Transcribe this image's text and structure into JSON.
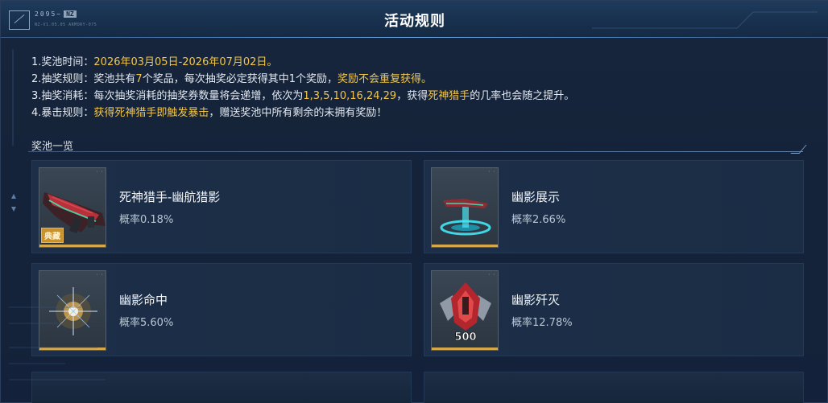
{
  "header": {
    "brand": "2095",
    "brand_tag": "NZ",
    "brand_sub": "NZ-V1.05.05 ARMORY-075",
    "title": "活动规则"
  },
  "rules": {
    "r1_prefix": "1.奖池时间：",
    "r1_time": "2026年03月05日-2026年07月02日。",
    "r2_a": "2.抽奖规则：奖池共有",
    "r2_count": "7",
    "r2_b": "个奖品，每次抽奖必定获得其中1个奖励，",
    "r2_hl": "奖励不会重复获得。",
    "r3_a": "3.抽奖消耗：每次抽奖消耗的抽奖券数量将会递增，依次为",
    "r3_seq": "1,3,5,10,16,24,29",
    "r3_b": "，获得",
    "r3_item": "死神猎手",
    "r3_c": "的几率也会随之提升。",
    "r4_a": "4.暴击规则：",
    "r4_hl": "获得死神猎手即触发暴击",
    "r4_b": "，赠送奖池中所有剩余的未拥有奖励！"
  },
  "pool": {
    "section_title": "奖池一览",
    "items": [
      {
        "name": "死神猎手-幽航猎影",
        "rate": "概率0.18%",
        "badge": "典藏",
        "icon": "weapon-rifle-icon"
      },
      {
        "name": "幽影展示",
        "rate": "概率2.66%",
        "icon": "hologram-display-icon"
      },
      {
        "name": "幽影命中",
        "rate": "概率5.60%",
        "icon": "hit-effect-icon"
      },
      {
        "name": "幽影歼灭",
        "rate": "概率12.78%",
        "icon": "kill-emblem-icon",
        "emblem_number": "500"
      }
    ]
  },
  "colors": {
    "highlight": "#f2c64a",
    "background": "#13213a",
    "card": "#1c2e46",
    "rarity_bar": "#d6a84a"
  }
}
